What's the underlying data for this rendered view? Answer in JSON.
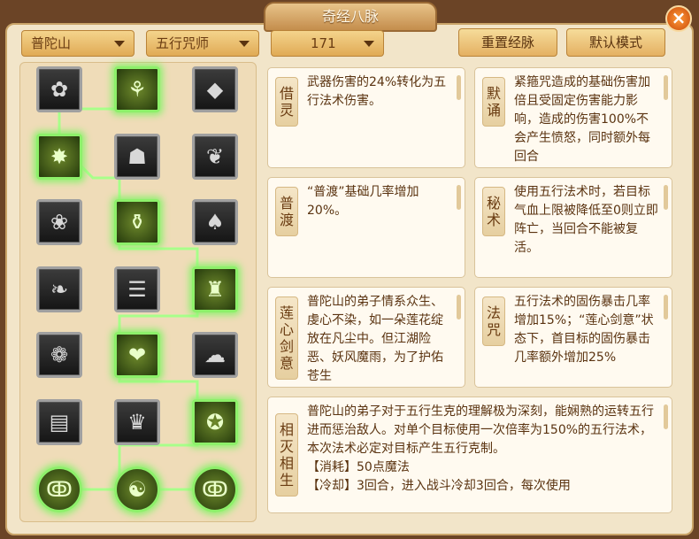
{
  "window": {
    "title": "奇经八脉",
    "close_label": "×"
  },
  "dropdowns": [
    {
      "value": "普陀山"
    },
    {
      "value": "五行咒师"
    },
    {
      "value": "171"
    }
  ],
  "buttons": {
    "reset": "重置经脉",
    "default_mode": "默认模式"
  },
  "nodes": [
    {
      "icon": "lotus-icon",
      "glyph": "✿",
      "active": false
    },
    {
      "icon": "vines-icon",
      "glyph": "⚘",
      "active": true
    },
    {
      "icon": "crystal-icon",
      "glyph": "◆",
      "active": false
    },
    {
      "icon": "burst-icon",
      "glyph": "✸",
      "active": true
    },
    {
      "icon": "bell-icon",
      "glyph": "☗",
      "active": false
    },
    {
      "icon": "flame-lotus-icon",
      "glyph": "❦",
      "active": false
    },
    {
      "icon": "flower-hand-icon",
      "glyph": "❀",
      "active": false
    },
    {
      "icon": "vase-icon",
      "glyph": "⚱",
      "active": true
    },
    {
      "icon": "mallet-icon",
      "glyph": "♠",
      "active": false
    },
    {
      "icon": "bird-icon",
      "glyph": "❧",
      "active": false
    },
    {
      "icon": "bamboo-icon",
      "glyph": "☰",
      "active": false
    },
    {
      "icon": "pagoda-icon",
      "glyph": "♜",
      "active": true
    },
    {
      "icon": "sprout-icon",
      "glyph": "❁",
      "active": false
    },
    {
      "icon": "heart-fish-icon",
      "glyph": "❤",
      "active": true
    },
    {
      "icon": "wave-icon",
      "glyph": "☁",
      "active": false
    },
    {
      "icon": "book-icon",
      "glyph": "▤",
      "active": false
    },
    {
      "icon": "crown-icon",
      "glyph": "♛",
      "active": false
    },
    {
      "icon": "pentagram-icon",
      "glyph": "✪",
      "active": true
    },
    {
      "icon": "spiral-icon",
      "glyph": "ↂ",
      "active": true
    },
    {
      "icon": "yinyang-icon",
      "glyph": "☯",
      "active": true
    },
    {
      "icon": "spiral-icon",
      "glyph": "ↂ",
      "active": true
    }
  ],
  "cards": [
    {
      "name": "借\n灵",
      "text": "武器伤害的24%转化为五行法术伤害。"
    },
    {
      "name": "默\n诵",
      "text": "紧箍咒造成的基础伤害加倍且受固定伤害能力影响，造成的伤害100%不会产生愤怒，同时额外每回合"
    },
    {
      "name": "普\n渡",
      "text": "“普渡”基础几率增加20%。"
    },
    {
      "name": "秘\n术",
      "text": "使用五行法术时，若目标气血上限被降低至0则立即阵亡，当回合不能被复活。"
    },
    {
      "name": "莲\n心\n剑\n意",
      "text": "普陀山的弟子情系众生、虔心不染，如一朵莲花绽放在凡尘中。但江湖险恶、妖风魔雨，为了护佑苍生"
    },
    {
      "name": "法\n咒",
      "text": "五行法术的固伤暴击几率增加15%；“莲心剑意”状态下，首目标的固伤暴击几率额外增加25%"
    },
    {
      "name": "相\n灭\n相\n生",
      "text": "普陀山的弟子对于五行生克的理解极为深刻，能娴熟的运转五行进而惩治敌人。对单个目标使用一次倍率为150%的五行法术，本次法术必定对目标产生五行克制。\n【消耗】50点魔法\n【冷却】3回合，进入战斗冷却3回合，每次使用"
    }
  ]
}
